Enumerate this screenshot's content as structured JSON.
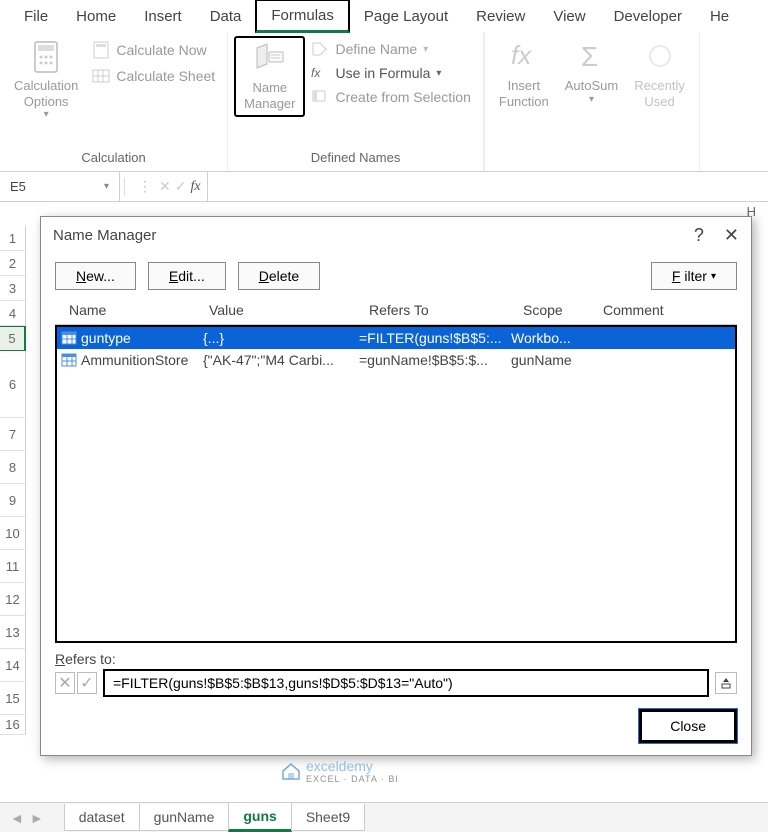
{
  "menu": {
    "tabs": [
      "File",
      "Home",
      "Insert",
      "Data",
      "Formulas",
      "Page Layout",
      "Review",
      "View",
      "Developer",
      "He"
    ],
    "active": "Formulas"
  },
  "ribbon": {
    "calculation": {
      "label": "Calculation",
      "options": "Calculation\nOptions",
      "calc_now": "Calculate Now",
      "calc_sheet": "Calculate Sheet"
    },
    "defined_names": {
      "label": "Defined Names",
      "name_manager": "Name\nManager",
      "define_name": "Define Name",
      "use_in_formula": "Use in Formula",
      "create_from_selection": "Create from Selection"
    },
    "function_lib": {
      "insert_function": "Insert\nFunction",
      "autosum": "AutoSum",
      "recently_used": "Recently\nUsed"
    }
  },
  "formula_bar": {
    "cell_ref": "E5"
  },
  "dialog": {
    "title": "Name Manager",
    "help": "?",
    "btn_new": "New...",
    "btn_edit": "Edit...",
    "btn_delete": "Delete",
    "btn_filter": "Filter",
    "headers": {
      "name": "Name",
      "value": "Value",
      "refers": "Refers To",
      "scope": "Scope",
      "comment": "Comment"
    },
    "rows": [
      {
        "name": "guntype",
        "value": "{...}",
        "refers": "=FILTER(guns!$B$5:...",
        "scope": "Workbo...",
        "comment": "",
        "selected": true
      },
      {
        "name": "AmmunitionStore",
        "value": "{\"AK-47\";\"M4 Carbi...",
        "refers": "=gunName!$B$5:$...",
        "scope": "gunName",
        "comment": "",
        "selected": false
      }
    ],
    "refers_label": "Refers to:",
    "refers_value": "=FILTER(guns!$B$5:$B$13,guns!$D$5:$D$13=\"Auto\")",
    "close": "Close"
  },
  "rows": [
    "1",
    "2",
    "3",
    "4",
    "5",
    "6",
    "7",
    "8",
    "9",
    "10",
    "11",
    "12",
    "13",
    "14",
    "15",
    "16"
  ],
  "col_H": "H",
  "sheets": {
    "tabs": [
      "dataset",
      "gunName",
      "guns",
      "Sheet9"
    ],
    "active": "guns"
  },
  "watermark": {
    "brand": "exceldemy",
    "tag": "EXCEL · DATA · BI"
  }
}
